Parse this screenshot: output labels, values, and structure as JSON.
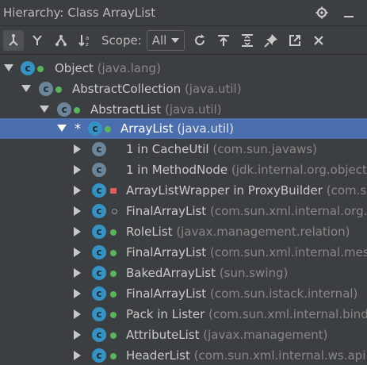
{
  "window": {
    "title": "Hierarchy:  Class ArrayList"
  },
  "toolbar": {
    "scope_label": "Scope:",
    "scope_value": "All"
  },
  "tree": {
    "rows": [
      {
        "name": "Object",
        "pkg": "(java.lang)"
      },
      {
        "name": "AbstractCollection",
        "pkg": "(java.util)"
      },
      {
        "name": "AbstractList",
        "pkg": "(java.util)"
      },
      {
        "star": "*",
        "name": "ArrayList",
        "pkg": "(java.util)"
      },
      {
        "name": "1 in CacheUtil",
        "pkg": "(com.sun.javaws)"
      },
      {
        "name": "1 in MethodNode",
        "pkg": "(jdk.internal.org.objectw"
      },
      {
        "name": "ArrayListWrapper in ProxyBuilder",
        "pkg": "(com.sun"
      },
      {
        "name": "FinalArrayList",
        "pkg": "(com.sun.xml.internal.org.jvn"
      },
      {
        "name": "RoleList",
        "pkg": "(javax.management.relation)"
      },
      {
        "name": "FinalArrayList",
        "pkg": "(com.sun.xml.internal.messa"
      },
      {
        "name": "BakedArrayList",
        "pkg": "(sun.swing)"
      },
      {
        "name": "FinalArrayList",
        "pkg": "(com.sun.istack.internal)"
      },
      {
        "name": "Pack in Lister",
        "pkg": "(com.sun.xml.internal.bind.v"
      },
      {
        "name": "AttributeList",
        "pkg": "(javax.management)"
      },
      {
        "name": "HeaderList",
        "pkg": "(com.sun.xml.internal.ws.api.m"
      }
    ]
  },
  "colors": {
    "background": "#3c3f41",
    "selection": "#4b6eaf",
    "class_icon": "#3592c4",
    "package_text": "#888888"
  }
}
